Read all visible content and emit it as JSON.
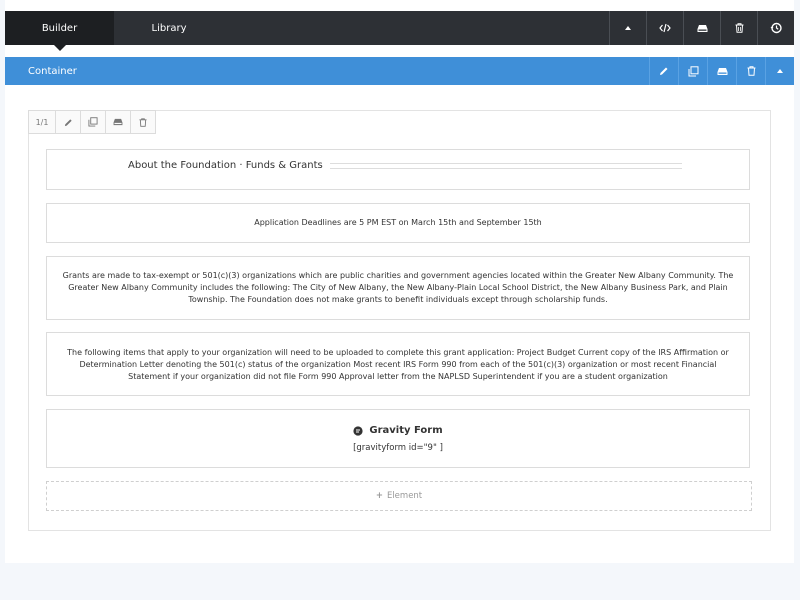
{
  "topbar": {
    "tabs": [
      {
        "label": "Builder",
        "active": true
      },
      {
        "label": "Library",
        "active": false
      }
    ],
    "actions": [
      "caret-up-icon",
      "code-icon",
      "save-template-icon",
      "trash-icon",
      "history-icon"
    ]
  },
  "container": {
    "title": "Container",
    "actions": [
      "pencil-icon",
      "duplicate-icon",
      "save-template-icon",
      "trash-icon",
      "caret-up-icon"
    ],
    "accent": "#3f8fd8"
  },
  "column": {
    "size_label": "1/1",
    "actions": [
      "pencil-icon",
      "duplicate-icon",
      "save-template-icon",
      "trash-icon"
    ]
  },
  "elements": {
    "heading": "About the Foundation · Funds & Grants",
    "deadline": "Application Deadlines are 5 PM EST on March 15th and September 15th",
    "eligibility": "Grants are made to tax-exempt or 501(c)(3) organizations which are public charities and government agencies located within the Greater New Albany Community. The Greater New Albany Community includes the following: The City of New Albany, the New Albany-Plain Local School District, the New Albany Business Park, and Plain Township. The Foundation does not make grants to benefit individuals except through scholarship funds.",
    "requirements": "The following items that apply to your organization will need to be uploaded to complete this grant application: Project Budget Current copy of the IRS Affirmation or Determination Letter denoting the 501(c) status of the organization Most recent IRS Form 990 from each of the 501(c)(3) organization or most recent Financial Statement if your organization did not file Form 990 Approval letter from the NAPLSD Superintendent if you are a student organization",
    "gravity_form_title": "Gravity Form",
    "gravity_form_code": "[gravityform id=\"9\" ]"
  },
  "add_element_label": "Element"
}
